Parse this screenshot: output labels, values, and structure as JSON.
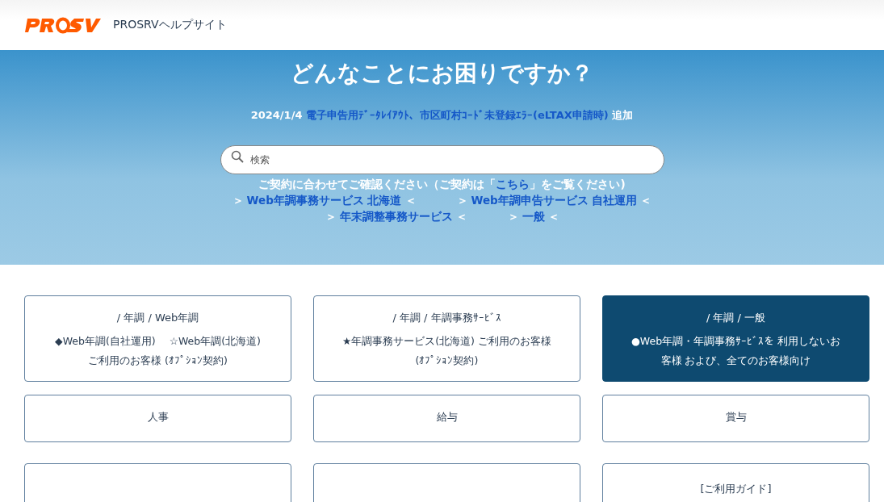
{
  "header": {
    "site_title": "PROSRVヘルプサイト"
  },
  "hero": {
    "title": "どんなことにお困りですか？",
    "notice": {
      "date": "2024/1/4",
      "link": "電子申告用ﾃﾞｰﾀﾚｲｱｳﾄ、市区町村ｺｰﾄﾞ未登録ｴﾗｰ(eLTAX申請時)",
      "suffix": "追加"
    },
    "search": {
      "placeholder": "検索"
    },
    "contract_note": {
      "before": "ご契約に合わせてご確認ください（ご契約は「",
      "link": "こちら",
      "after": "」をご覧ください)"
    },
    "service_links": [
      [
        {
          "open": "＞",
          "link": "Web年調事務サービス 北海道",
          "close": "＜"
        },
        {
          "open": "＞",
          "link": "Web年調申告サービス 自社運用",
          "close": "＜"
        }
      ],
      [
        {
          "open": "＞",
          "link": "年末調整事務サービス",
          "close": "＜"
        },
        {
          "open": "＞",
          "link": "一般",
          "close": "＜"
        }
      ]
    ]
  },
  "cards": [
    {
      "title": "/ 年調 / Web年調",
      "lines": [
        "◆Web年調(自社運用)　 ☆Web年調(北海道)",
        "ご利用のお客様 (ｵﾌﾟｼｮﾝ契約)"
      ],
      "selected": false
    },
    {
      "title": "/ 年調 / 年調事務ｻｰﾋﾞｽ",
      "lines": [
        "★年調事務サービス(北海道) ご利用のお客様",
        "(ｵﾌﾟｼｮﾝ契約)"
      ],
      "selected": false
    },
    {
      "title": "/ 年調 / 一般",
      "lines": [
        "●Web年調・年調事務ｻｰﾋﾞｽを 利用しないお",
        "客様 および、全てのお客様向け"
      ],
      "selected": true
    },
    {
      "title": "人事",
      "selected": false
    },
    {
      "title": "給与",
      "selected": false
    },
    {
      "title": "賞与",
      "selected": false
    },
    {
      "selected": false
    },
    {
      "selected": false
    },
    {
      "title": "[ご利用ガイド]",
      "selected": false
    }
  ]
}
